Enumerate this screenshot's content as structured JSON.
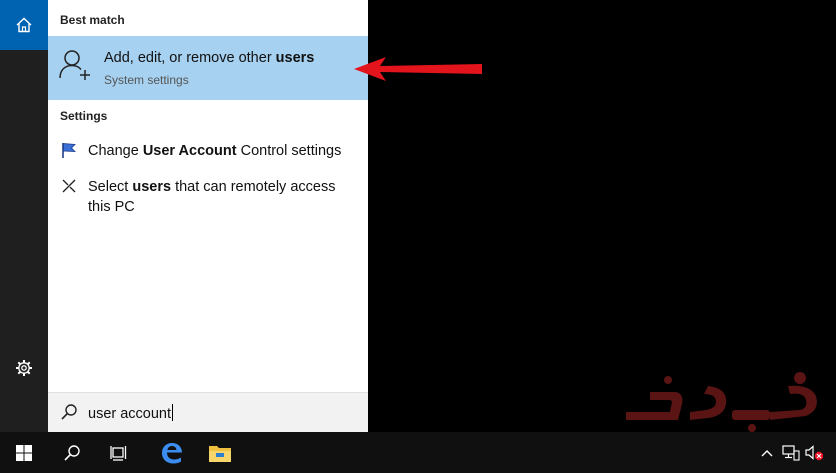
{
  "sections": {
    "best_match_header": "Best match",
    "settings_header": "Settings"
  },
  "best_match": {
    "title_prefix": "Add, edit, or remove other ",
    "title_bold": "users",
    "subtitle": "System settings",
    "icon": "user-add-icon"
  },
  "settings_results": [
    {
      "pre": "Change ",
      "bold": "User Account",
      "post": " Control settings",
      "icon": "uac-flag-icon"
    },
    {
      "pre": "Select ",
      "bold": "users",
      "post": " that can remotely access this PC",
      "icon": "remote-access-icon"
    }
  ],
  "search": {
    "query": "user account",
    "icon": "search-icon"
  },
  "rail": {
    "home_icon": "home-icon",
    "settings_icon": "gear-icon",
    "home_color": "#0063b1"
  },
  "taskbar": {
    "items": [
      "start-icon",
      "search-icon",
      "task-view-icon",
      "edge-icon",
      "file-explorer-icon"
    ],
    "tray": [
      "chevron-up-icon",
      "network-icon",
      "volume-muted-icon"
    ]
  },
  "colors": {
    "selection": "#a6d1f0",
    "arrow": "#e3141b",
    "watermark": "#5a1414"
  },
  "watermark": {
    "text": "وب رمز"
  }
}
